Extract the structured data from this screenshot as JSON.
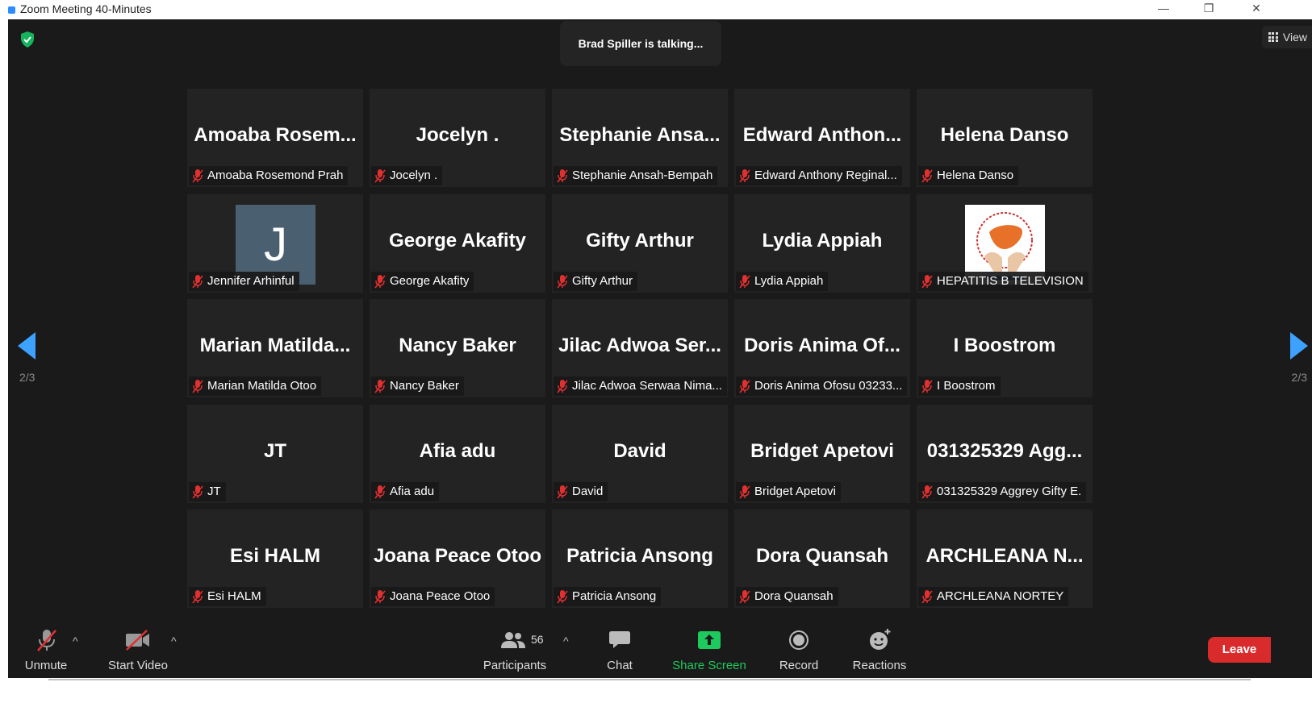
{
  "window": {
    "title": "Zoom Meeting 40-Minutes",
    "minimize": "—",
    "restore": "❐",
    "close": "✕"
  },
  "header": {
    "talking": "Brad Spiller is talking...",
    "view_label": "View"
  },
  "pager": {
    "left_page": "2/3",
    "right_page": "2/3"
  },
  "colors": {
    "accent": "#3da2ff",
    "leave": "#d92b2b",
    "muted": "#e03030",
    "share": "#1ec95e",
    "shield": "#16b35e"
  },
  "participants": [
    {
      "big": "Amoaba  Rosem...",
      "name": "Amoaba Rosemond Prah"
    },
    {
      "big": "Jocelyn .",
      "name": "Jocelyn ."
    },
    {
      "big": "Stephanie  Ansa...",
      "name": "Stephanie Ansah-Bempah"
    },
    {
      "big": "Edward  Anthon...",
      "name": "Edward Anthony Reginal..."
    },
    {
      "big": "Helena Danso",
      "name": "Helena Danso"
    },
    {
      "big": "",
      "avatar": "J",
      "name": "Jennifer Arhinful"
    },
    {
      "big": "George Akafity",
      "name": "George Akafity"
    },
    {
      "big": "Gifty Arthur",
      "name": "Gifty Arthur"
    },
    {
      "big": "Lydia Appiah",
      "name": "Lydia Appiah"
    },
    {
      "big": "",
      "logo": "hepatitis-logo",
      "name": "HEPATITIS B TELEVISION"
    },
    {
      "big": "Marian  Matilda...",
      "name": "Marian Matilda Otoo"
    },
    {
      "big": "Nancy Baker",
      "name": "Nancy Baker"
    },
    {
      "big": "Jilac  Adwoa  Ser...",
      "name": "Jilac Adwoa Serwaa Nima..."
    },
    {
      "big": "Doris  Anima  Of...",
      "name": "Doris Anima Ofosu 03233..."
    },
    {
      "big": "I Boostrom",
      "name": "I Boostrom"
    },
    {
      "big": "JT",
      "name": "JT"
    },
    {
      "big": "Afia adu",
      "name": "Afia adu"
    },
    {
      "big": "David",
      "name": "David"
    },
    {
      "big": "Bridget Apetovi",
      "name": "Bridget Apetovi"
    },
    {
      "big": "031325329  Agg...",
      "name": "031325329 Aggrey Gifty E."
    },
    {
      "big": "Esi HALM",
      "name": "Esi HALM"
    },
    {
      "big": "Joana Peace Otoo",
      "name": "Joana Peace Otoo"
    },
    {
      "big": "Patricia Ansong",
      "name": "Patricia Ansong"
    },
    {
      "big": "Dora Quansah",
      "name": "Dora Quansah"
    },
    {
      "big": "ARCHLEANA  N...",
      "name": "ARCHLEANA NORTEY"
    }
  ],
  "toolbar": {
    "unmute": "Unmute",
    "start_video": "Start Video",
    "participants": "Participants",
    "participants_count": "56",
    "chat": "Chat",
    "share_screen": "Share Screen",
    "record": "Record",
    "reactions": "Reactions",
    "leave": "Leave",
    "caret": "^"
  }
}
